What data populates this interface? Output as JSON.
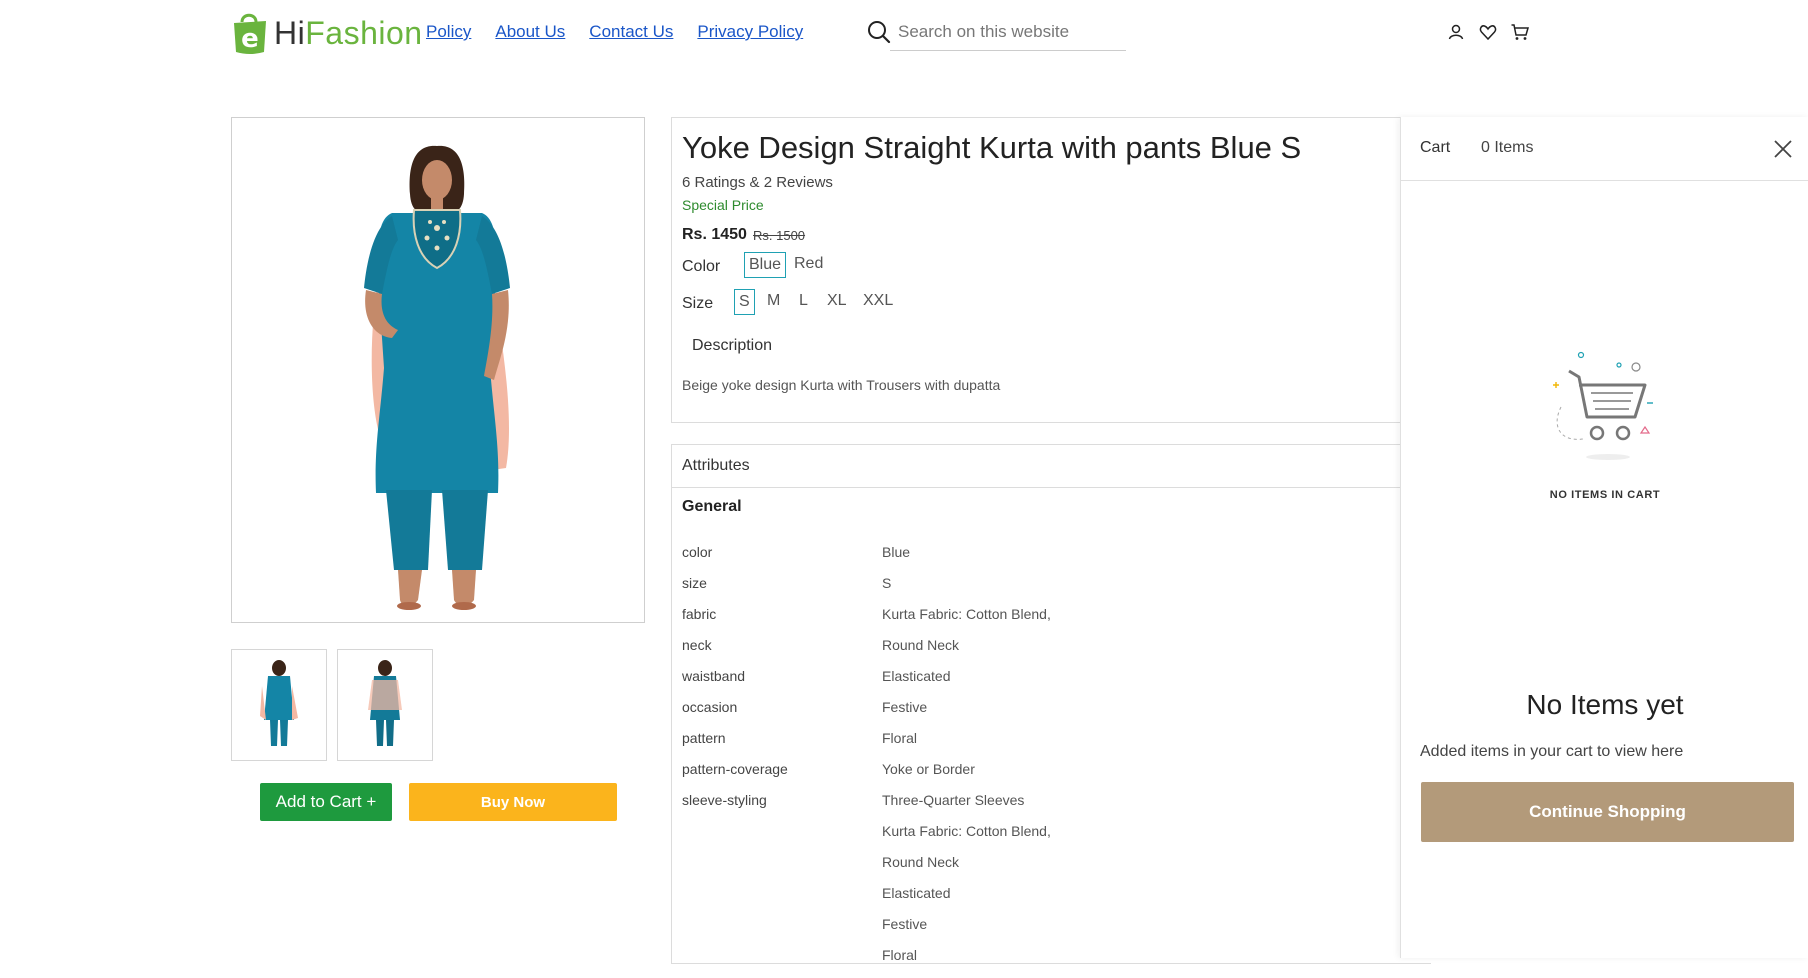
{
  "brand": {
    "prefix": "Hi",
    "suffix": "Fashion",
    "logo_letter": "e",
    "green": "#6ab43e"
  },
  "nav": {
    "items": [
      {
        "label": "Policy"
      },
      {
        "label": "About Us"
      },
      {
        "label": "Contact Us"
      },
      {
        "label": "Privacy Policy"
      }
    ]
  },
  "search": {
    "placeholder": "Search on this website"
  },
  "header_icons": [
    "user-icon",
    "heart-icon",
    "cart-icon"
  ],
  "product": {
    "title": "Yoke Design Straight Kurta with pants Blue S",
    "ratings": "6 Ratings & 2 Reviews",
    "special": "Special Price",
    "price": "Rs. 1450",
    "mrp": "Rs. 1500",
    "color_label": "Color",
    "colors": [
      "Blue",
      "Red"
    ],
    "selected_color": "Blue",
    "size_label": "Size",
    "sizes": [
      "S",
      "M",
      "L",
      "XL",
      "XXL"
    ],
    "selected_size": "S",
    "description_heading": "Description",
    "description": "Beige yoke design Kurta with Trousers with dupatta",
    "add_to_cart": "Add to Cart +",
    "buy_now": "Buy Now",
    "garment_color": "#1485a6",
    "dupatta_color": "#f3b8a3"
  },
  "attributes": {
    "heading": "Attributes",
    "group": "General",
    "rows": [
      {
        "k": "color",
        "v": "Blue"
      },
      {
        "k": "size",
        "v": "S"
      },
      {
        "k": "fabric",
        "v": "Kurta Fabric: Cotton Blend,"
      },
      {
        "k": "neck",
        "v": "Round Neck"
      },
      {
        "k": "waistband",
        "v": "Elasticated"
      },
      {
        "k": "occasion",
        "v": "Festive"
      },
      {
        "k": "pattern",
        "v": "Floral"
      },
      {
        "k": "pattern-coverage",
        "v": "Yoke or Border"
      },
      {
        "k": "sleeve-styling",
        "v": "Three-Quarter Sleeves"
      },
      {
        "k": "",
        "v": "Kurta Fabric: Cotton Blend,"
      },
      {
        "k": "",
        "v": "Round Neck"
      },
      {
        "k": "",
        "v": "Elasticated"
      },
      {
        "k": "",
        "v": "Festive"
      },
      {
        "k": "",
        "v": "Floral"
      }
    ]
  },
  "cart": {
    "title": "Cart",
    "count": "0 Items",
    "empty_caption": "NO ITEMS IN CART",
    "empty_title": "No Items yet",
    "empty_sub": "Added items in your cart to view here",
    "continue_label": "Continue Shopping",
    "accent": "#b39a7a"
  }
}
